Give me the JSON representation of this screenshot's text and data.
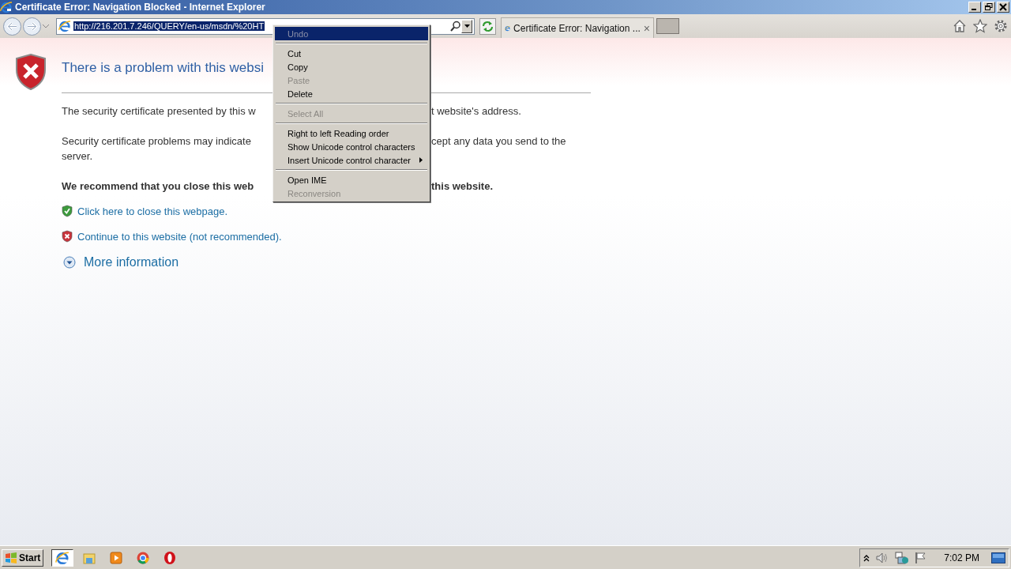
{
  "window": {
    "title": "Certificate Error: Navigation Blocked - Internet Explorer"
  },
  "address_bar": {
    "value": "http://216.201.7.246/QUERY/en-us/msdn/%20HT"
  },
  "tabs": [
    {
      "label": "Certificate Error: Navigation ...",
      "selected": true,
      "close": "×"
    }
  ],
  "page": {
    "heading": "There is a problem with this websi",
    "paragraphs": [
      {
        "left": "The security certificate presented by this w",
        "right": "t website's address."
      },
      {
        "left": "Security certificate problems may indicate",
        "right": "cept any data you send to the",
        "continuation": "server."
      }
    ],
    "recommendation": {
      "left": "We recommend that you close this web",
      "right": "this website."
    },
    "links": [
      {
        "kind": "safe",
        "label": "Click here to close this webpage."
      },
      {
        "kind": "unsafe",
        "label": "Continue to this website (not recommended)."
      }
    ],
    "more_info": "More information"
  },
  "context_menu": {
    "items": [
      {
        "kind": "item",
        "label": "Undo",
        "disabled": true,
        "selected": true
      },
      {
        "kind": "separator"
      },
      {
        "kind": "item",
        "label": "Cut",
        "disabled": false,
        "selected": false
      },
      {
        "kind": "item",
        "label": "Copy",
        "disabled": false,
        "selected": false
      },
      {
        "kind": "item",
        "label": "Paste",
        "disabled": true,
        "selected": false
      },
      {
        "kind": "item",
        "label": "Delete",
        "disabled": false,
        "selected": false
      },
      {
        "kind": "separator"
      },
      {
        "kind": "item",
        "label": "Select All",
        "disabled": true,
        "selected": false
      },
      {
        "kind": "separator"
      },
      {
        "kind": "item",
        "label": "Right to left Reading order",
        "disabled": false,
        "selected": false
      },
      {
        "kind": "item",
        "label": "Show Unicode control characters",
        "disabled": false,
        "selected": false
      },
      {
        "kind": "submenu",
        "label": "Insert Unicode control character",
        "disabled": false,
        "selected": false
      },
      {
        "kind": "separator"
      },
      {
        "kind": "item",
        "label": "Open IME",
        "disabled": false,
        "selected": false
      },
      {
        "kind": "item",
        "label": "Reconversion",
        "disabled": true,
        "selected": false
      }
    ]
  },
  "taskbar": {
    "start": "Start",
    "apps": [
      {
        "kind": "ie",
        "selected": true
      },
      {
        "kind": "folder",
        "selected": false
      },
      {
        "kind": "media",
        "selected": false
      },
      {
        "kind": "chrome",
        "selected": false
      },
      {
        "kind": "opera",
        "selected": false
      }
    ],
    "clock": "7:02 PM"
  }
}
